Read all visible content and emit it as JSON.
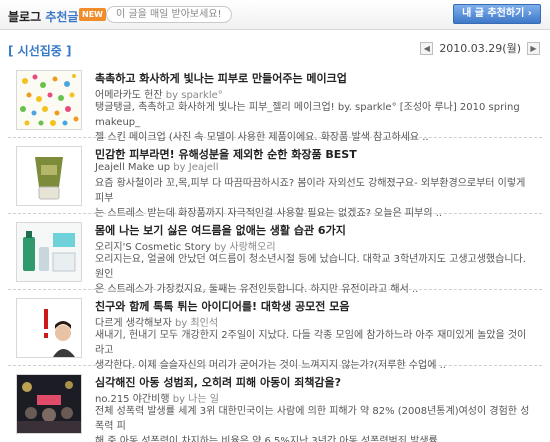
{
  "header": {
    "brand_prefix": "블로그 ",
    "brand_accent": "추천글",
    "badge": "NEW",
    "subscribe_label": "이 글을 매일 받아보세요!",
    "recommend_button": "내 글 추천하기 ›"
  },
  "section": {
    "title": "[ 시선집중 ]",
    "date": "2010.03.29(월)",
    "prev": "◀",
    "next": "▶"
  },
  "items": [
    {
      "title": "촉촉하고 화사하게 빛나는 피부로 만들어주는 메이크업",
      "blog": "어메라카도 헌잔",
      "by": "by",
      "author": "sparkle°",
      "line1": "탱글탱글, 촉촉하고 화사하게 빛나는 피부_젤리 메이크업! by. sparkle° [조성아 루나] 2010 spring makeup_",
      "line2": "젤 스킨 메이크업 (사진 속 모델이 사용한 제품이에요. 화장품 발색 참고하세요 ..",
      "thumb": "confetti"
    },
    {
      "title": "민감한 피부라면! 유해성분을 제외한 순한 화장품 BEST",
      "blog": "Jeajell Make up",
      "by": "by",
      "author": "Jeajell",
      "line1": "요즘 황사철이라 꼬,목,피부 다 따끔따끔하시죠? 봄이라 자외선도 강해졌구요- 외부환경으로부터 이렇게 피부",
      "line2": "는 스트레스 받는데 화장품까지 자극적인걸 사용할 필요는 없겠죠? 오늘은 피부의 ..",
      "thumb": "tube"
    },
    {
      "title": "몸에 나는 보기 싫은 여드름을 없애는 생활 습관 6가지",
      "blog": "오리지'S Cosmetic Story",
      "by": "by",
      "author": "사랑해오리",
      "line1": "오리지는요, 얼굴에 안났던 여드름이 청소년시절 등에 났습니다. 대학교 3학년까지도 고생고생했습니다. 원인",
      "line2": "은 스트레스가 가장컸지요, 둘째는 유전인듯합니다. 하지만 유전이라고 해서 ..",
      "thumb": "bottles"
    },
    {
      "title": "친구와 함께 톡톡 튀는 아이디어를! 대학생 공모전 모음",
      "blog": "다르게 생각해보자",
      "by": "by",
      "author": "최인석",
      "line1": "새내기, 헌내기 모두 개강한지 2주일이 지났다. 다들 각종 모임에 참가하느라 아주 재미있게 놀았을 것이라고",
      "line2": "생각한다. 이제 슬슬자신의 머리가 굳어가는 것이 느껴지지 않는가?(저루한 수업에 ..",
      "thumb": "person"
    },
    {
      "title": "심각해진 아동 성범죄, 오히려 피해 아동이 죄책감을?",
      "blog": "no.215 야간비행",
      "by": "by",
      "author": "나는 일",
      "line1": "전체 성폭력 발생률 세계 3위 대한민국이는 사람에 의한 피해가 약 82% (2008년통계)여성이 경험한 성폭력 피",
      "line2": "해 중 아동 성폭력이 차지하는 비율은 약 6.5%지난 3년간 아동 성폭력범죄 발생률 ..",
      "thumb": "crowd"
    }
  ],
  "colors": {
    "accent_blue": "#3778c7",
    "badge_orange": "#f08c2a"
  }
}
